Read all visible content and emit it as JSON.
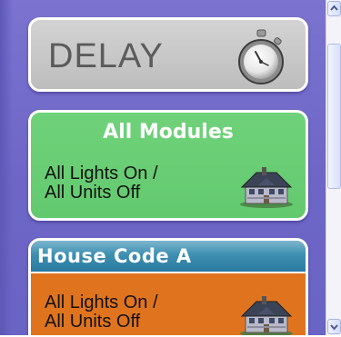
{
  "delay": {
    "label": "DELAY",
    "icon": "stopwatch-icon"
  },
  "all_modules": {
    "title": "All Modules",
    "line1": "All Lights On /",
    "line2": "All Units Off",
    "icon": "house-icon"
  },
  "house_code_a": {
    "title": "House Code A",
    "line1": "All Lights On /",
    "line2": "All Units Off",
    "icon": "house-icon"
  },
  "colors": {
    "background": "#6d66c6",
    "delay_card": "#c8c8c8",
    "all_modules_card": "#66cc72",
    "house_code_card": "#e0741e",
    "house_code_header": "#3d8fb1"
  }
}
